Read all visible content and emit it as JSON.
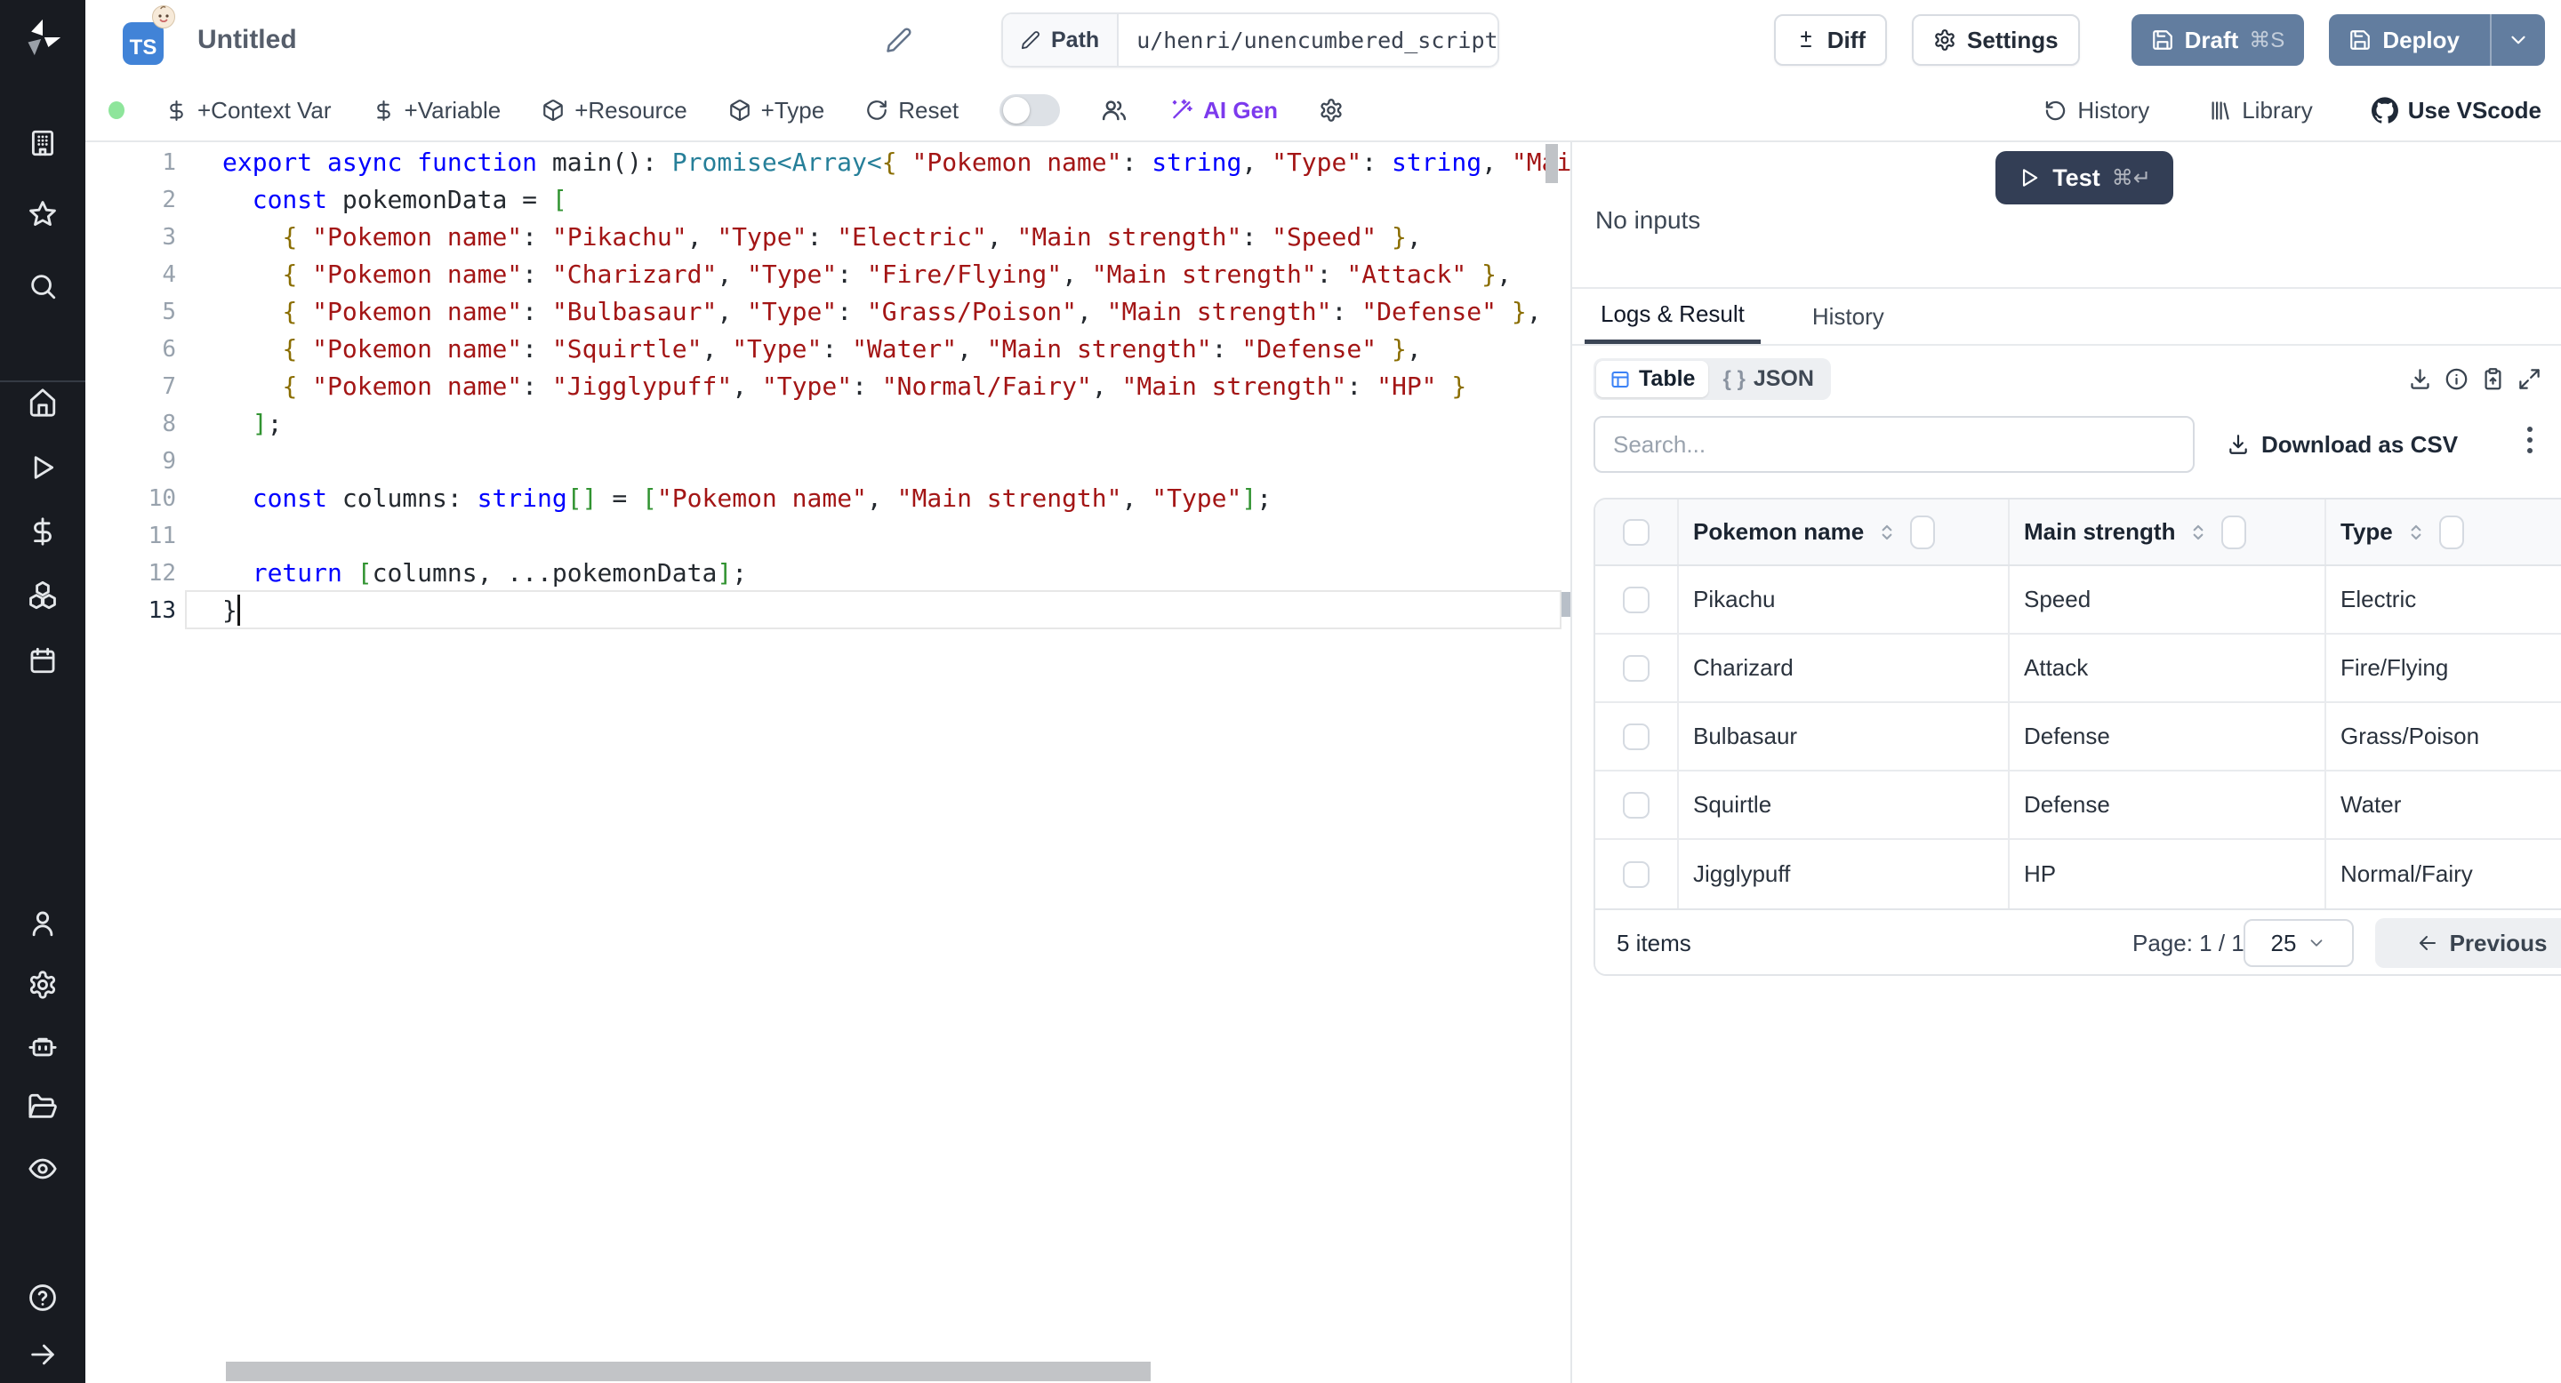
{
  "header": {
    "title": "Untitled",
    "lang_badge": "TS",
    "path_label": "Path",
    "path_value": "u/henri/unencumbered_script",
    "diff": "Diff",
    "settings": "Settings",
    "draft": "Draft",
    "draft_shortcut": "⌘S",
    "deploy": "Deploy"
  },
  "toolbar": {
    "context_var": "+Context Var",
    "variable": "+Variable",
    "resource": "+Resource",
    "type": "+Type",
    "reset": "Reset",
    "ai_gen": "AI Gen",
    "history": "History",
    "library": "Library",
    "use_vscode": "Use VScode"
  },
  "editor": {
    "cursor_line": 13,
    "lines": [
      {
        "n": 1,
        "segs": [
          [
            "k",
            "export"
          ],
          [
            "d",
            " "
          ],
          [
            "k",
            "async"
          ],
          [
            "d",
            " "
          ],
          [
            "k",
            "function"
          ],
          [
            "d",
            " main(): "
          ],
          [
            "t",
            "Promise<Array<"
          ],
          [
            "o",
            "{"
          ],
          [
            "d",
            " "
          ],
          [
            "s",
            "\"Pokemon name\""
          ],
          [
            "d",
            ": "
          ],
          [
            "k",
            "string"
          ],
          [
            "d",
            ", "
          ],
          [
            "s",
            "\"Type\""
          ],
          [
            "d",
            ": "
          ],
          [
            "k",
            "string"
          ],
          [
            "d",
            ", "
          ],
          [
            "s",
            "\"Mai"
          ]
        ]
      },
      {
        "n": 2,
        "segs": [
          [
            "d",
            "  "
          ],
          [
            "k",
            "const"
          ],
          [
            "d",
            " pokemonData = "
          ],
          [
            "b",
            "["
          ]
        ]
      },
      {
        "n": 3,
        "segs": [
          [
            "d",
            "    "
          ],
          [
            "o",
            "{"
          ],
          [
            "d",
            " "
          ],
          [
            "s",
            "\"Pokemon name\""
          ],
          [
            "d",
            ": "
          ],
          [
            "s",
            "\"Pikachu\""
          ],
          [
            "d",
            ", "
          ],
          [
            "s",
            "\"Type\""
          ],
          [
            "d",
            ": "
          ],
          [
            "s",
            "\"Electric\""
          ],
          [
            "d",
            ", "
          ],
          [
            "s",
            "\"Main strength\""
          ],
          [
            "d",
            ": "
          ],
          [
            "s",
            "\"Speed\""
          ],
          [
            "d",
            " "
          ],
          [
            "o",
            "}"
          ],
          [
            "d",
            ","
          ]
        ]
      },
      {
        "n": 4,
        "segs": [
          [
            "d",
            "    "
          ],
          [
            "o",
            "{"
          ],
          [
            "d",
            " "
          ],
          [
            "s",
            "\"Pokemon name\""
          ],
          [
            "d",
            ": "
          ],
          [
            "s",
            "\"Charizard\""
          ],
          [
            "d",
            ", "
          ],
          [
            "s",
            "\"Type\""
          ],
          [
            "d",
            ": "
          ],
          [
            "s",
            "\"Fire/Flying\""
          ],
          [
            "d",
            ", "
          ],
          [
            "s",
            "\"Main strength\""
          ],
          [
            "d",
            ": "
          ],
          [
            "s",
            "\"Attack\""
          ],
          [
            "d",
            " "
          ],
          [
            "o",
            "}"
          ],
          [
            "d",
            ","
          ]
        ]
      },
      {
        "n": 5,
        "segs": [
          [
            "d",
            "    "
          ],
          [
            "o",
            "{"
          ],
          [
            "d",
            " "
          ],
          [
            "s",
            "\"Pokemon name\""
          ],
          [
            "d",
            ": "
          ],
          [
            "s",
            "\"Bulbasaur\""
          ],
          [
            "d",
            ", "
          ],
          [
            "s",
            "\"Type\""
          ],
          [
            "d",
            ": "
          ],
          [
            "s",
            "\"Grass/Poison\""
          ],
          [
            "d",
            ", "
          ],
          [
            "s",
            "\"Main strength\""
          ],
          [
            "d",
            ": "
          ],
          [
            "s",
            "\"Defense\""
          ],
          [
            "d",
            " "
          ],
          [
            "o",
            "}"
          ],
          [
            "d",
            ","
          ]
        ]
      },
      {
        "n": 6,
        "segs": [
          [
            "d",
            "    "
          ],
          [
            "o",
            "{"
          ],
          [
            "d",
            " "
          ],
          [
            "s",
            "\"Pokemon name\""
          ],
          [
            "d",
            ": "
          ],
          [
            "s",
            "\"Squirtle\""
          ],
          [
            "d",
            ", "
          ],
          [
            "s",
            "\"Type\""
          ],
          [
            "d",
            ": "
          ],
          [
            "s",
            "\"Water\""
          ],
          [
            "d",
            ", "
          ],
          [
            "s",
            "\"Main strength\""
          ],
          [
            "d",
            ": "
          ],
          [
            "s",
            "\"Defense\""
          ],
          [
            "d",
            " "
          ],
          [
            "o",
            "}"
          ],
          [
            "d",
            ","
          ]
        ]
      },
      {
        "n": 7,
        "segs": [
          [
            "d",
            "    "
          ],
          [
            "o",
            "{"
          ],
          [
            "d",
            " "
          ],
          [
            "s",
            "\"Pokemon name\""
          ],
          [
            "d",
            ": "
          ],
          [
            "s",
            "\"Jigglypuff\""
          ],
          [
            "d",
            ", "
          ],
          [
            "s",
            "\"Type\""
          ],
          [
            "d",
            ": "
          ],
          [
            "s",
            "\"Normal/Fairy\""
          ],
          [
            "d",
            ", "
          ],
          [
            "s",
            "\"Main strength\""
          ],
          [
            "d",
            ": "
          ],
          [
            "s",
            "\"HP\""
          ],
          [
            "d",
            " "
          ],
          [
            "o",
            "}"
          ]
        ]
      },
      {
        "n": 8,
        "segs": [
          [
            "d",
            "  "
          ],
          [
            "b",
            "]"
          ],
          [
            "d",
            ";"
          ]
        ]
      },
      {
        "n": 9,
        "segs": []
      },
      {
        "n": 10,
        "segs": [
          [
            "d",
            "  "
          ],
          [
            "k",
            "const"
          ],
          [
            "d",
            " columns: "
          ],
          [
            "k",
            "string"
          ],
          [
            "b",
            "[]"
          ],
          [
            "d",
            " = "
          ],
          [
            "b",
            "["
          ],
          [
            "s",
            "\"Pokemon name\""
          ],
          [
            "d",
            ", "
          ],
          [
            "s",
            "\"Main strength\""
          ],
          [
            "d",
            ", "
          ],
          [
            "s",
            "\"Type\""
          ],
          [
            "b",
            "]"
          ],
          [
            "d",
            ";"
          ]
        ]
      },
      {
        "n": 11,
        "segs": []
      },
      {
        "n": 12,
        "segs": [
          [
            "d",
            "  "
          ],
          [
            "k",
            "return"
          ],
          [
            "d",
            " "
          ],
          [
            "b",
            "["
          ],
          [
            "d",
            "columns, ...pokemonData"
          ],
          [
            "b",
            "]"
          ],
          [
            "d",
            ";"
          ]
        ]
      },
      {
        "n": 13,
        "segs": [
          [
            "d",
            "}"
          ]
        ],
        "current": true
      }
    ]
  },
  "run_panel": {
    "test": "Test",
    "test_shortcut": "⌘↵",
    "no_inputs": "No inputs",
    "tab_logs": "Logs & Result",
    "tab_history": "History",
    "view_table": "Table",
    "json_braces": "{ }",
    "view_json": "JSON",
    "search_placeholder": "Search...",
    "download_csv": "Download as CSV"
  },
  "result_table": {
    "columns": [
      "Pokemon name",
      "Main strength",
      "Type"
    ],
    "rows": [
      [
        "Pikachu",
        "Speed",
        "Electric"
      ],
      [
        "Charizard",
        "Attack",
        "Fire/Flying"
      ],
      [
        "Bulbasaur",
        "Defense",
        "Grass/Poison"
      ],
      [
        "Squirtle",
        "Defense",
        "Water"
      ],
      [
        "Jigglypuff",
        "HP",
        "Normal/Fairy"
      ]
    ],
    "items_text": "5 items",
    "page_text": "Page: 1 / 1",
    "page_size": "25",
    "previous": "Previous"
  },
  "colors": {
    "accent_blue": "#3b82f6",
    "deploy_slate": "#627d9f",
    "test_navy": "#333e55",
    "ai_purple": "#7c3aed",
    "keyword_blue": "#0000ff",
    "type_teal": "#267f99",
    "string_red": "#a31515",
    "bracket_green": "#319331",
    "brace_gold": "#8a6d00",
    "status_green": "#8ee59b"
  }
}
